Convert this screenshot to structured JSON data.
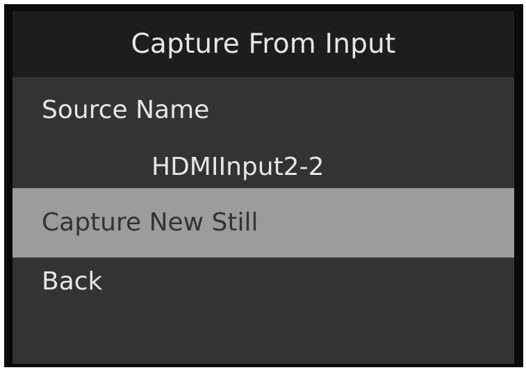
{
  "header": {
    "title": "Capture From Input"
  },
  "menu": {
    "source_label": "Source Name",
    "source_value": "HDMIInput2-2",
    "capture_label": "Capture New Still",
    "back_label": "Back",
    "selected_item": "Capture New Still"
  },
  "colors": {
    "background": "#333333",
    "title_bar": "#1d1d1d",
    "selection_highlight": "#9c9c9c",
    "text": "#e6e6e6"
  }
}
